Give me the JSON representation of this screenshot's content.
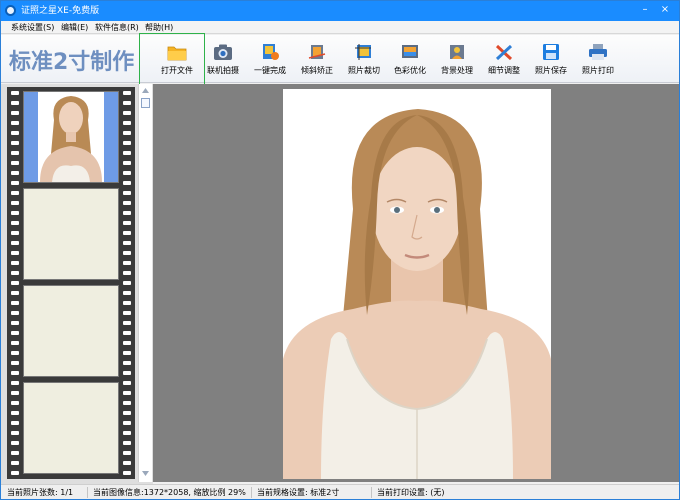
{
  "window": {
    "title": "证照之星XE-免费版",
    "minimize": "–",
    "close": "×"
  },
  "menu": [
    {
      "label": "系统设置(S)"
    },
    {
      "label": "编辑(E)"
    },
    {
      "label": "软件信息(R)"
    },
    {
      "label": "帮助(H)"
    }
  ],
  "toolbar": {
    "brand": "标准2寸制作",
    "tools": [
      {
        "label": "打开文件",
        "icon": "folder-icon"
      },
      {
        "label": "联机拍摄",
        "icon": "camera-icon"
      },
      {
        "label": "一键完成",
        "icon": "one-click-icon"
      },
      {
        "label": "倾斜矫正",
        "icon": "tilt-correct-icon"
      },
      {
        "label": "照片裁切",
        "icon": "crop-icon"
      },
      {
        "label": "色彩优化",
        "icon": "color-optimize-icon"
      },
      {
        "label": "背景处理",
        "icon": "background-icon"
      },
      {
        "label": "细节调整",
        "icon": "detail-adjust-icon"
      },
      {
        "label": "照片保存",
        "icon": "save-icon"
      },
      {
        "label": "照片打印",
        "icon": "printer-icon"
      }
    ]
  },
  "colors": {
    "titlebar": "#1a8cff",
    "brand": "#6e8fc0",
    "thumb_bg": "#6e9be6",
    "preview_bg": "#808080",
    "highlight": "#2fb24a"
  },
  "status": [
    {
      "text": "当前照片张数: 1/1"
    },
    {
      "text": "当前图像信息:1372*2058, 缩放比例 29%"
    },
    {
      "text": "当前规格设置: 标准2寸"
    },
    {
      "text": "当前打印设置: (无)"
    }
  ]
}
